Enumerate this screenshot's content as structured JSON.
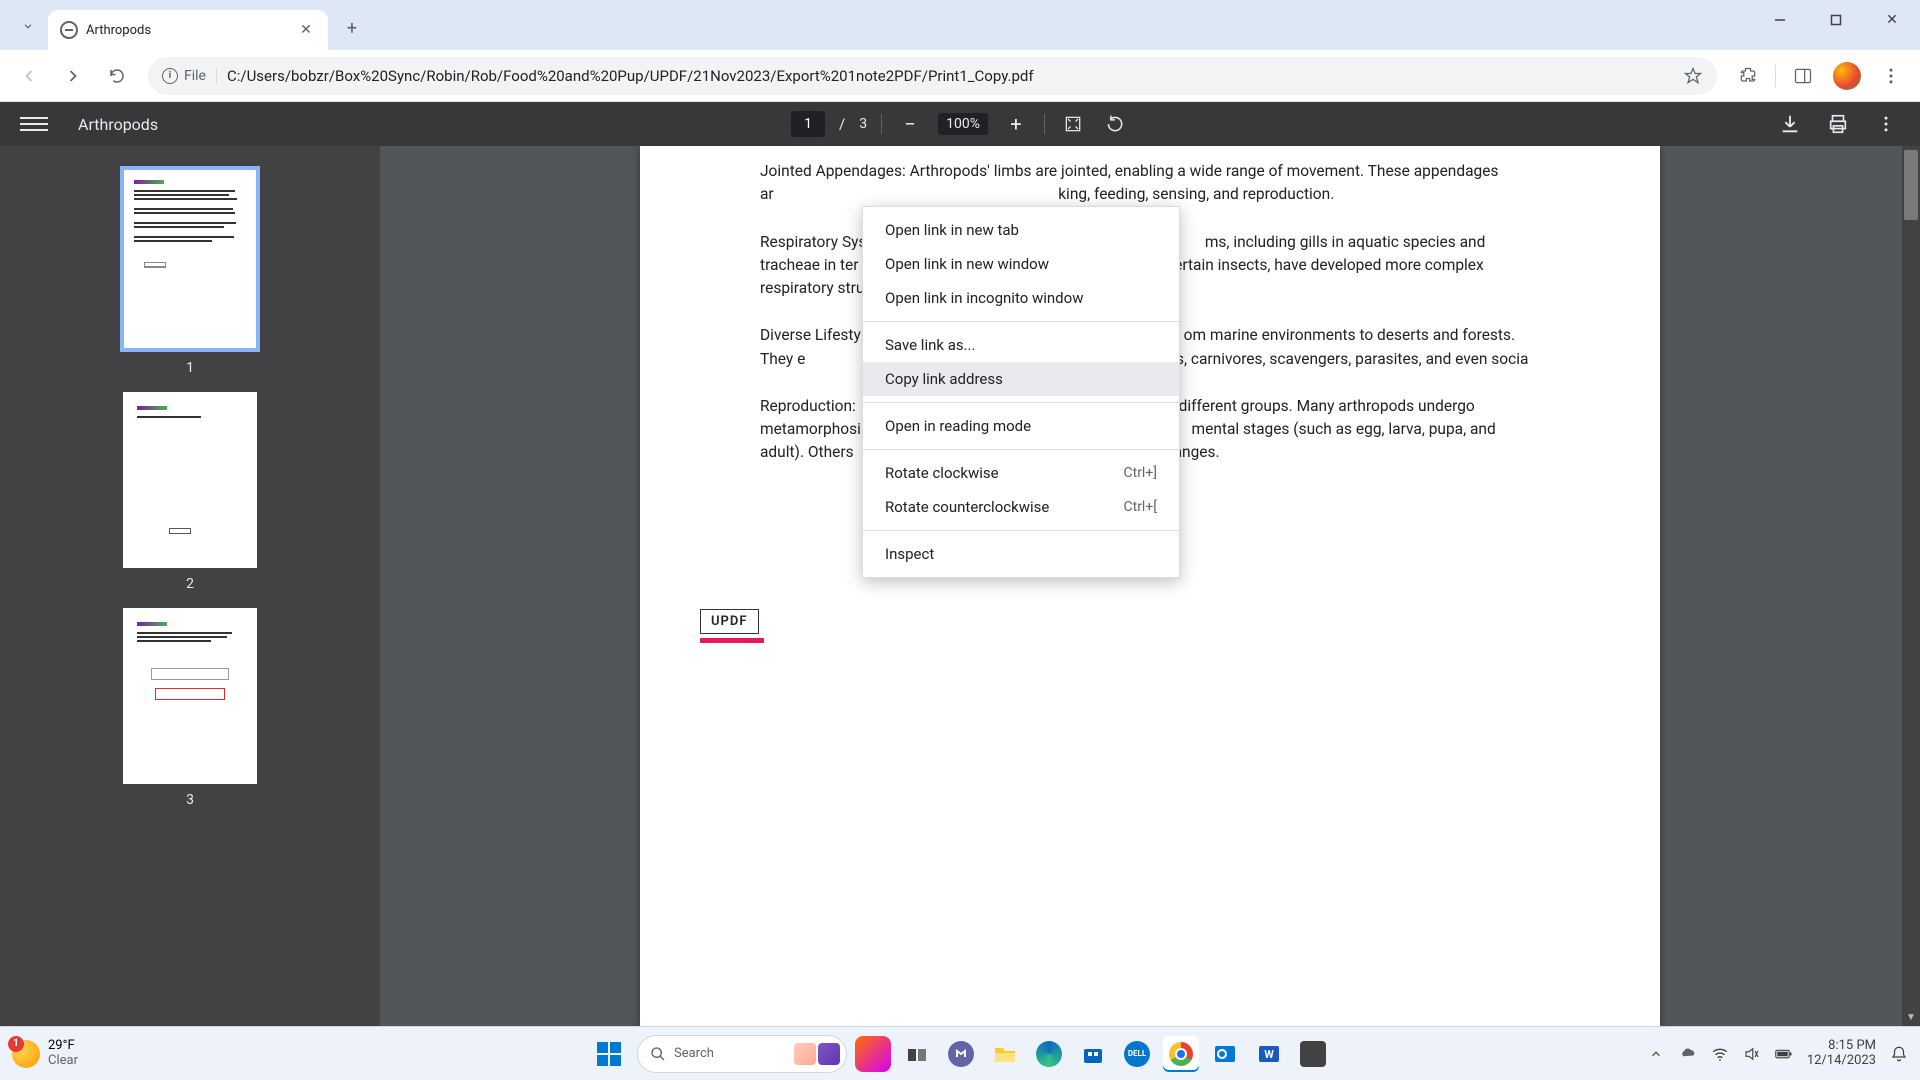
{
  "browser": {
    "tab_title": "Arthropods",
    "url": "C:/Users/bobzr/Box%20Sync/Robin/Rob/Food%20and%20Pup/UPDF/21Nov2023/Export%201note2PDF/Print1_Copy.pdf",
    "file_chip": "File"
  },
  "pdf": {
    "title": "Arthropods",
    "page_current": "1",
    "page_sep": "/",
    "page_total": "3",
    "zoom": "100%",
    "thumbs": [
      {
        "num": "1",
        "selected": true
      },
      {
        "num": "2",
        "selected": false
      },
      {
        "num": "3",
        "selected": false
      }
    ],
    "updf_label": "UPDF",
    "paragraphs": {
      "p1_a": "Jointed Appendages: Arthropods' limbs are jointed, enabling a wide range of movement. These appendages ar",
      "p1_b": "king, feeding, sensing, and reproduction.",
      "p2_a": "Respiratory Sys",
      "p2_b": "ms, including gills in aquatic species and tracheae in ter",
      "p2_c": "certain insects, have developed more complex respiratory stru",
      "p3_a": "Diverse Lifesty",
      "p3_b": "om marine environments to deserts and forests. They e",
      "p3_c": "erbivores, carnivores, scavengers, parasites, and even socia",
      "p4_a": "Reproduction:",
      "p4_b": "different groups. Many arthropods undergo metamorphosi",
      "p4_c": "mental stages (such as egg, larva, pupa, and adult). Others ",
      "p4_d": "hanges."
    }
  },
  "context_menu": {
    "open_tab": "Open link in new tab",
    "open_window": "Open link in new window",
    "open_incognito": "Open link in incognito window",
    "save_as": "Save link as...",
    "copy_link": "Copy link address",
    "reading_mode": "Open in reading mode",
    "rotate_cw": "Rotate clockwise",
    "rotate_cw_key": "Ctrl+]",
    "rotate_ccw": "Rotate counterclockwise",
    "rotate_ccw_key": "Ctrl+[",
    "inspect": "Inspect"
  },
  "taskbar": {
    "weather_badge": "1",
    "temp": "29°F",
    "cond": "Clear",
    "search_placeholder": "Search",
    "time": "8:15 PM",
    "date": "12/14/2023"
  }
}
